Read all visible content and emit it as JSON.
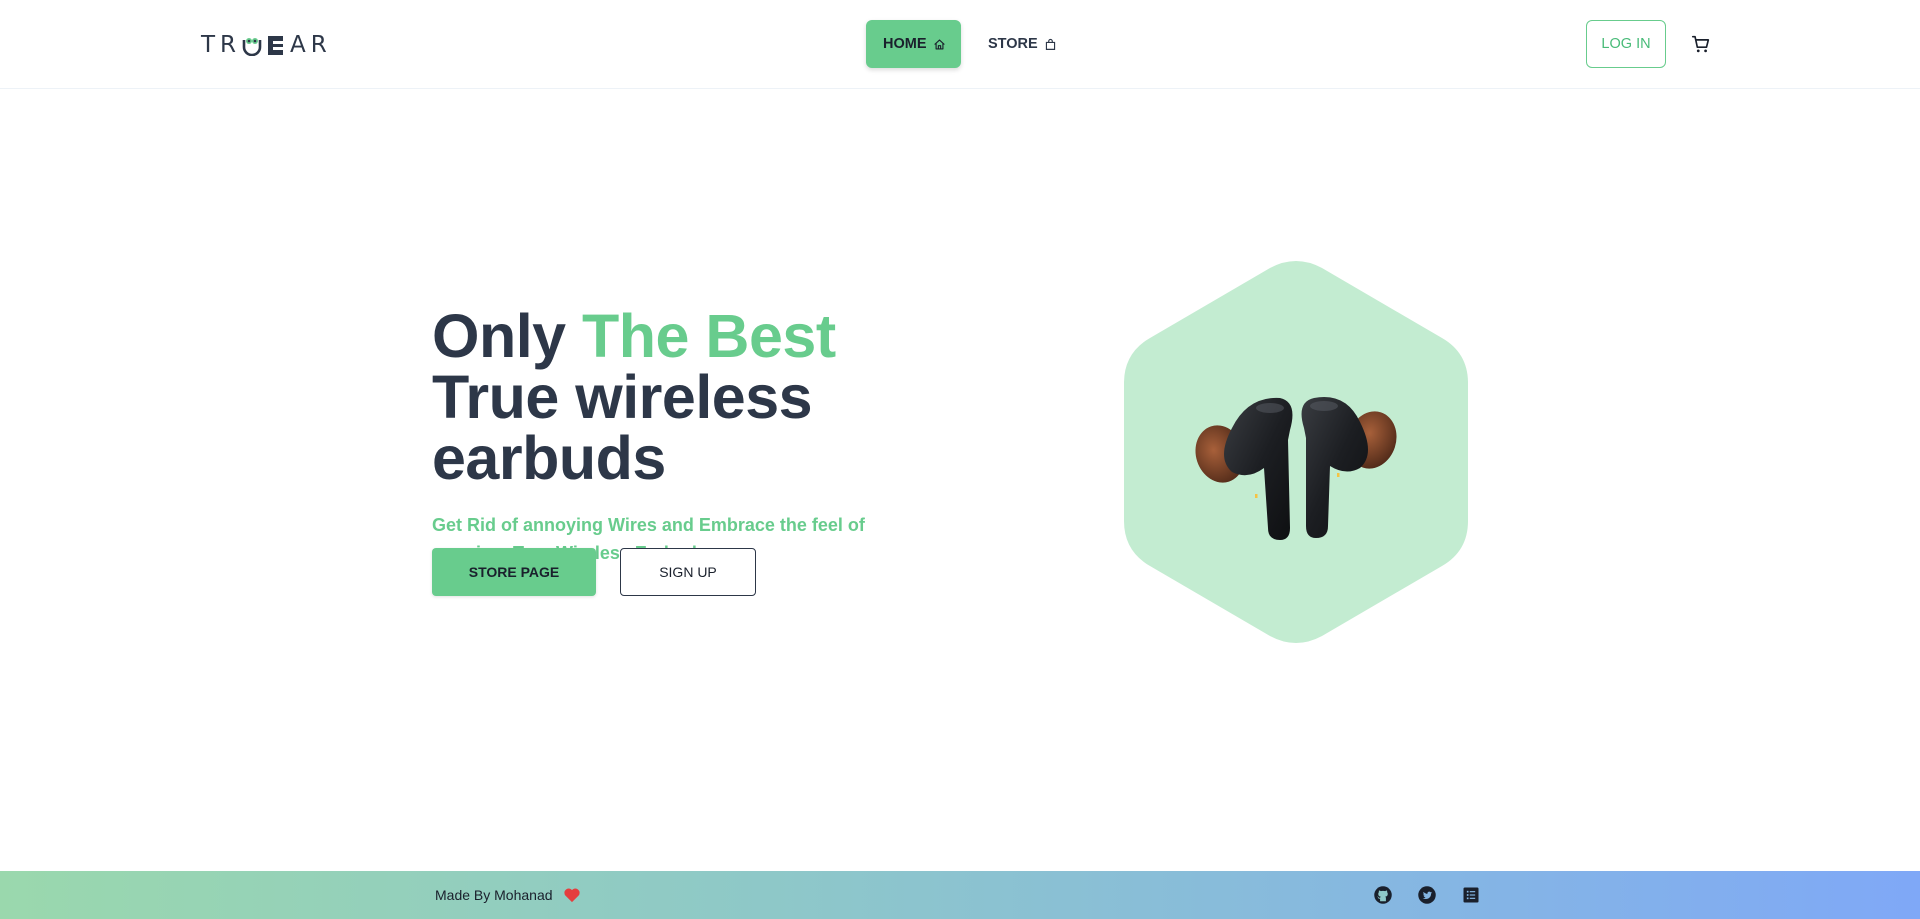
{
  "brand": {
    "logo_text_part1": "TR",
    "logo_text_part2": "AR",
    "logo_alt": "TRUEEAR"
  },
  "nav": {
    "items": [
      {
        "label": "HOME",
        "icon": "home-icon",
        "active": true
      },
      {
        "label": "STORE",
        "icon": "bag-icon",
        "active": false
      }
    ]
  },
  "header": {
    "login_label": "LOG IN",
    "cart_icon": "cart-icon"
  },
  "hero": {
    "headline_part1": "Only ",
    "headline_accent": "The Best",
    "headline_part2": " True wireless earbuds",
    "subhead": "Get Rid of annoying Wires and Embrace the feel of premium True Wireless Earbuds",
    "primary_cta": "STORE PAGE",
    "secondary_cta": "SIGN UP",
    "image": "earbuds-product-image"
  },
  "footer": {
    "made_by": "Made By Mohanad",
    "heart_icon": "heart-icon",
    "social_icons": [
      "github-icon",
      "twitter-icon",
      "notes-icon"
    ]
  },
  "colors": {
    "accent": "#68cc8d",
    "text_dark": "#2d3748",
    "hexagon_fill": "#c3ecd1",
    "heart": "#e53e3e"
  }
}
